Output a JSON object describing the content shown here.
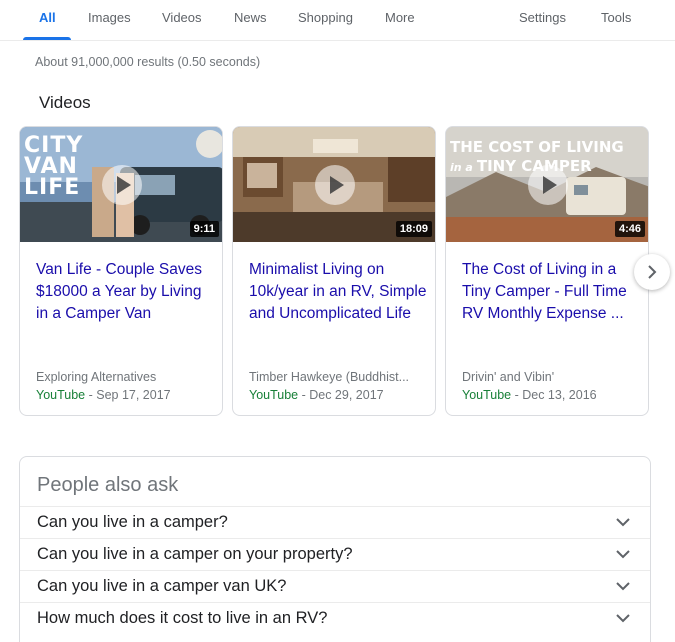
{
  "nav": {
    "tabs": [
      "All",
      "Images",
      "Videos",
      "News",
      "Shopping",
      "More"
    ],
    "settings": "Settings",
    "tools": "Tools"
  },
  "result_stats": "About 91,000,000 results (0.50 seconds)",
  "videos": {
    "section_title": "Videos",
    "items": [
      {
        "title": "Van Life - Couple Saves $18000 a Year by Living in a Camper Van",
        "duration": "9:11",
        "channel": "Exploring Alternatives",
        "source": "YouTube",
        "date": " - Sep 17, 2017",
        "thumb_text": [
          "CITY",
          "VAN",
          "LIFE"
        ]
      },
      {
        "title": "Minimalist Living on 10k/year in an RV, Simple and Uncomplicated Life",
        "duration": "18:09",
        "channel": "Timber Hawkeye (Buddhist...",
        "source": "YouTube",
        "date": " - Dec 29, 2017"
      },
      {
        "title": "The Cost of Living in a Tiny Camper - Full Time RV Monthly Expense ...",
        "duration": "4:46",
        "channel": "Drivin' and Vibin'",
        "source": "YouTube",
        "date": " - Dec 13, 2016",
        "thumb_text": [
          "THE COST OF LIVING",
          "in a",
          "TINY CAMPER"
        ]
      }
    ]
  },
  "people_also_ask": {
    "title": "People also ask",
    "questions": [
      "Can you live in a camper?",
      "Can you live in a camper on your property?",
      "Can you live in a camper van UK?",
      "How much does it cost to live in an RV?"
    ]
  },
  "icons": {
    "next": "chevron-right-icon",
    "expand": "chevron-down-icon",
    "play": "play-icon"
  },
  "colors": {
    "accent": "#1a73e8",
    "link": "#1a0dab",
    "source": "#188038",
    "muted": "#70757a"
  }
}
